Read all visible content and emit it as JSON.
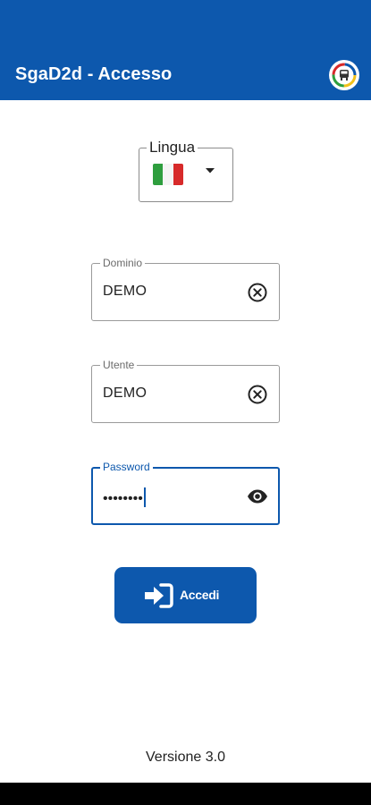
{
  "appbar": {
    "title": "SgaD2d - Accesso",
    "color": "#0d58ad",
    "logo_icon": "brand-logo-icon"
  },
  "language": {
    "legend": "Lingua",
    "selected_flag": "italy-flag-icon",
    "dropdown_icon": "caret-down-icon"
  },
  "fields": {
    "domain": {
      "label": "Dominio",
      "value": "DEMO",
      "action_icon": "clear-circle-icon"
    },
    "user": {
      "label": "Utente",
      "value": "DEMO",
      "action_icon": "clear-circle-icon"
    },
    "password": {
      "label": "Password",
      "value": "••••••••",
      "action_icon": "eye-icon"
    }
  },
  "login_button": {
    "label": "Accedi",
    "icon": "login-arrow-icon"
  },
  "footer": {
    "version": "Versione 3.0"
  }
}
